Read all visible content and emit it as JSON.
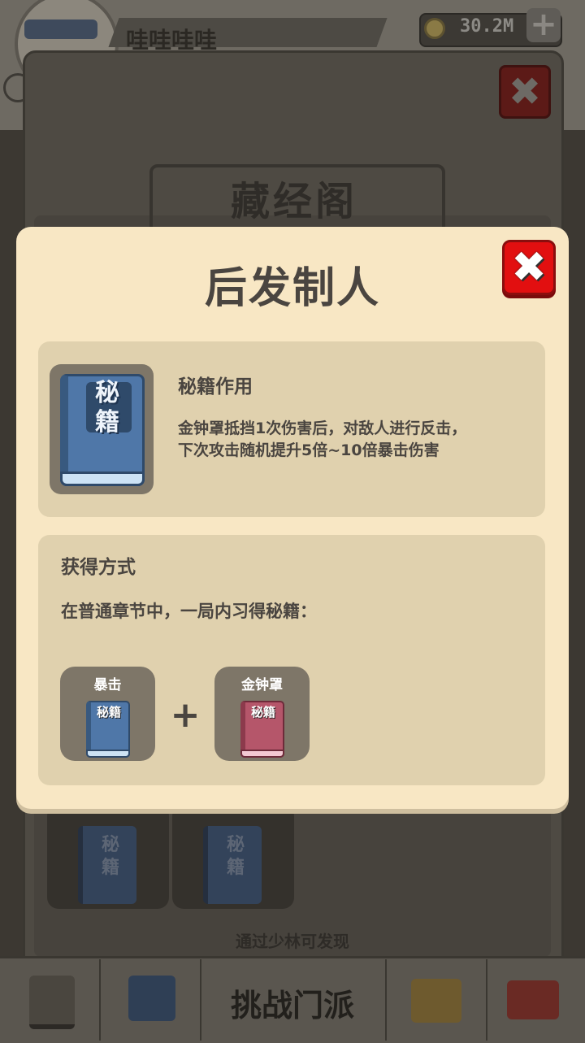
{
  "header": {
    "player_name": "哇哇哇哇",
    "coins": "30.2M",
    "add_label": "+"
  },
  "library": {
    "title": "藏经阁",
    "close_label": "✖",
    "hint": "通过少林可发现",
    "books": [
      "秘籍",
      "秘籍"
    ]
  },
  "nav": {
    "challenge_label": "挑战门派"
  },
  "modal": {
    "title": "后发制人",
    "close_label": "✖",
    "book_label": "秘籍",
    "effect": {
      "heading": "秘籍作用",
      "lines": [
        "金钟罩抵挡1次伤害后，对敌人进行反击，",
        "下次攻击随机提升5倍~10倍暴击伤害"
      ]
    },
    "acquire": {
      "heading": "获得方式",
      "desc": "在普通章节中，一局内习得秘籍：",
      "components": [
        {
          "name": "暴击",
          "book_label": "秘籍",
          "color": "#4f77a8"
        },
        {
          "name": "金钟罩",
          "book_label": "秘籍",
          "color": "#b5566a"
        }
      ],
      "plus": "+"
    }
  },
  "colors": {
    "modal_bg": "#f8e7c4",
    "section_bg": "#e0d1ae",
    "close_red": "#e20f10",
    "text_dark": "#4a4540"
  }
}
